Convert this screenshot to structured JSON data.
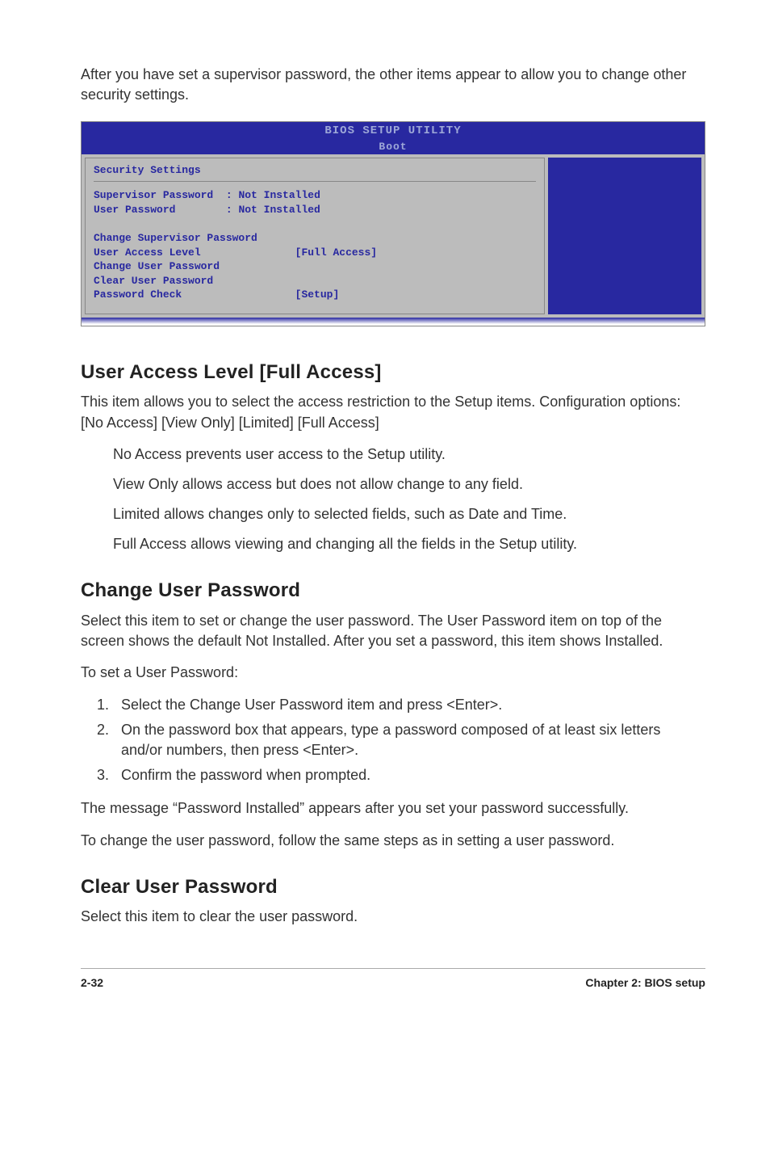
{
  "intro": "After you have set a supervisor password, the other items appear to allow you to change other security settings.",
  "bios": {
    "title": "BIOS SETUP UTILITY",
    "tab": "Boot",
    "section_heading": "Security Settings",
    "rows": {
      "sup_label": "Supervisor Password",
      "sup_val": "Not Installed",
      "user_label": "User Password",
      "user_val": "Not Installed",
      "change_sup": "Change Supervisor Password",
      "ual_label": "User Access Level",
      "ual_val": "[Full Access]",
      "change_user": "Change User Password",
      "clear_user": "Clear User Password",
      "pwcheck_label": "Password Check",
      "pwcheck_val": "[Setup]"
    }
  },
  "sections": {
    "ual": {
      "heading": "User Access Level [Full Access]",
      "p1": "This item allows you to select the access restriction to the Setup items. Configuration options: [No Access] [View Only] [Limited] [Full Access]",
      "b1": "No Access prevents user access to the Setup utility.",
      "b2": "View Only allows access but does not allow change to any field.",
      "b3": "Limited allows changes only to selected fields, such as Date and Time.",
      "b4": "Full Access allows viewing and changing all the fields in the Setup utility."
    },
    "cup": {
      "heading": "Change User Password",
      "p1": "Select this item to set or change the user password. The User Password item on top of the screen shows the default Not Installed. After you set a password, this item shows Installed.",
      "p2": "To set a User Password:",
      "s1": "Select the Change User Password item and press <Enter>.",
      "s2": "On the password box that appears, type a password composed of at least six letters and/or numbers, then press <Enter>.",
      "s3": "Confirm the password when prompted.",
      "p3": "The message “Password Installed” appears after you set your password successfully.",
      "p4": "To change the user password, follow the same steps as in setting a user password."
    },
    "clr": {
      "heading": "Clear User Password",
      "p1": "Select this item to clear the user password."
    }
  },
  "footer": {
    "left": "2-32",
    "right": "Chapter 2: BIOS setup"
  }
}
